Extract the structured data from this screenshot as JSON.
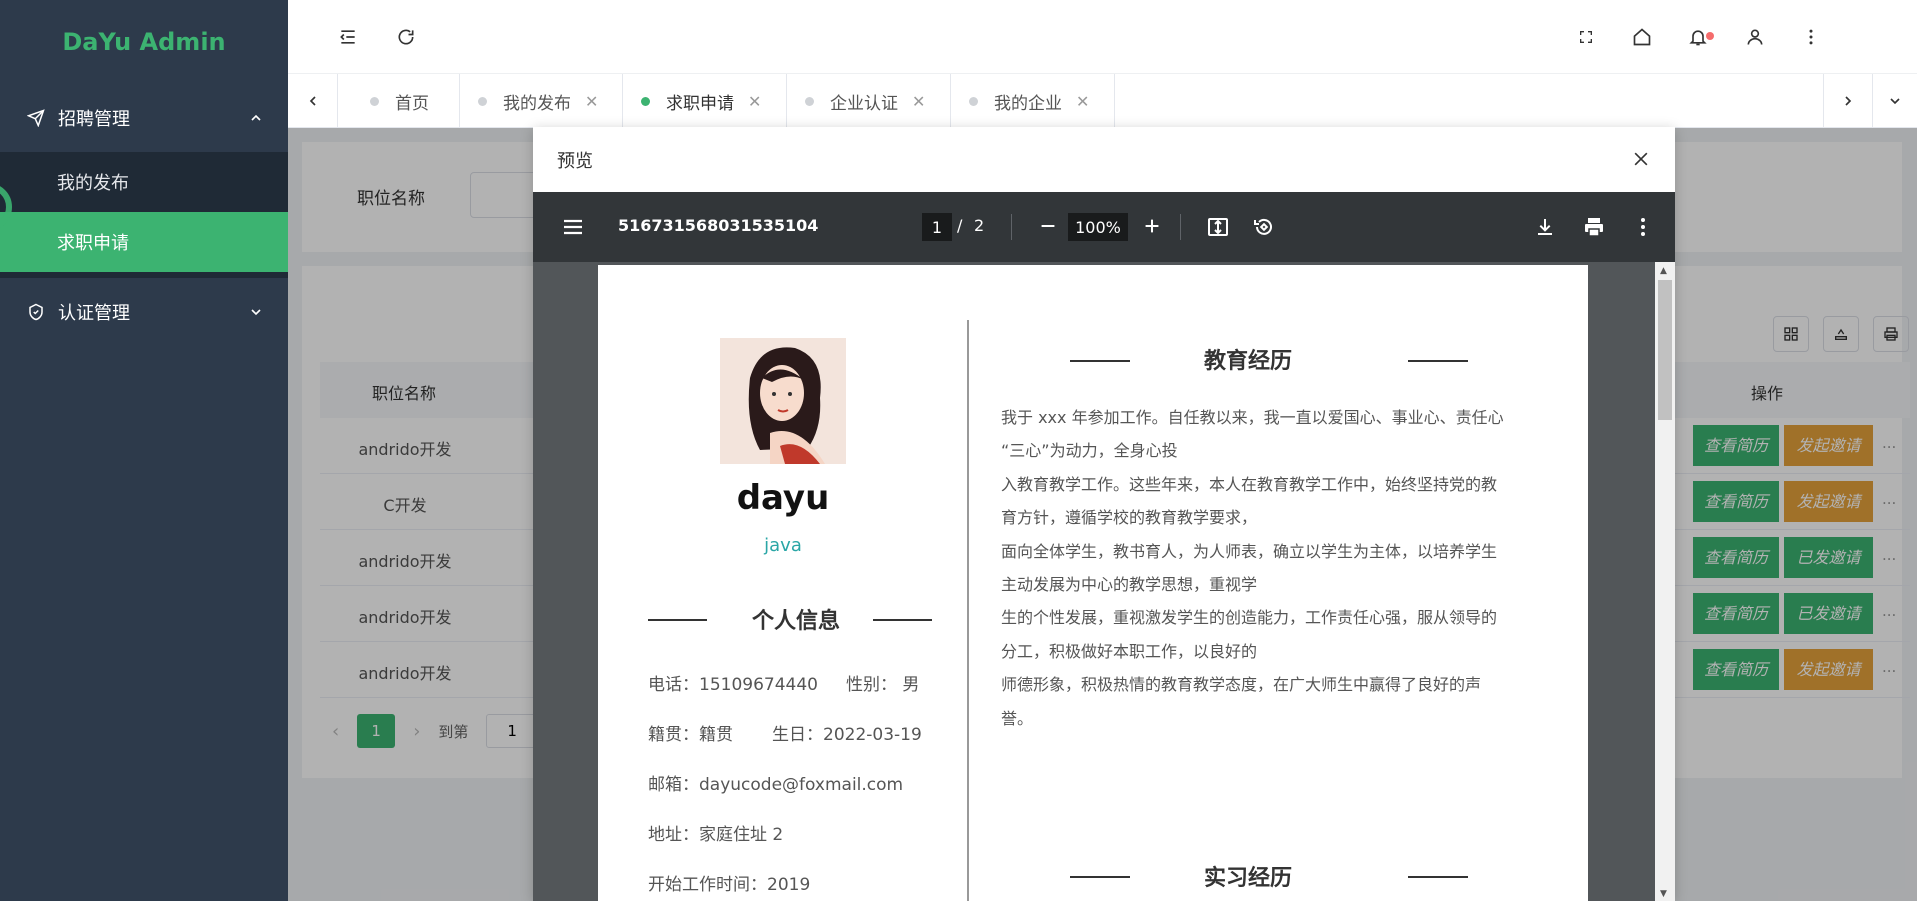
{
  "app": {
    "title": "DaYu Admin"
  },
  "sidebar": {
    "groups": [
      {
        "label": "招聘管理",
        "items": [
          {
            "label": "我的发布"
          },
          {
            "label": "求职申请"
          }
        ]
      },
      {
        "label": "认证管理"
      }
    ]
  },
  "tabs": [
    {
      "label": "首页"
    },
    {
      "label": "我的发布"
    },
    {
      "label": "求职申请"
    },
    {
      "label": "企业认证"
    },
    {
      "label": "我的企业"
    }
  ],
  "background": {
    "filter_label": "职位名称",
    "table": {
      "col_title": "职位名称",
      "col_ops": "操作",
      "rows": [
        {
          "title": "andrido开发",
          "view": "查看简历",
          "invite": "发起邀请",
          "invited": false
        },
        {
          "title": "C开发",
          "view": "查看简历",
          "invite": "发起邀请",
          "invited": false
        },
        {
          "title": "andrido开发",
          "view": "查看简历",
          "invite": "已发邀请",
          "invited": true
        },
        {
          "title": "andrido开发",
          "view": "查看简历",
          "invite": "已发邀请",
          "invited": true
        },
        {
          "title": "andrido开发",
          "view": "查看简历",
          "invite": "发起邀请",
          "invited": false
        }
      ],
      "more": "..."
    },
    "pagination": {
      "current": "1",
      "goto_label": "到第",
      "goto_value": "1"
    }
  },
  "dialog": {
    "title": "预览",
    "pdf": {
      "filename": "516731568031535104",
      "page_current": "1",
      "page_sep": "/",
      "page_total": "2",
      "zoom": "100%"
    },
    "resume": {
      "name": "dayu",
      "position": "java",
      "personal_heading": "个人信息",
      "phone": "电话：15109674440",
      "gender": "性别：  男",
      "origin": "籍贯：籍贯",
      "birthday": "生日：2022-03-19",
      "email": "邮箱：dayucode@foxmail.com",
      "address": "地址：家庭住址 2",
      "start_work": "开始工作时间：2019",
      "education_heading": "教育经历",
      "education_lines": [
        "我于 xxx 年参加工作。自任教以来，我一直以爱国心、事业心、责任心",
        "“三心”为动力，全身心投",
        "入教育教学工作。这些年来，本人在教育教学工作中，始终坚持党的教",
        "育方针，遵循学校的教育教学要求，",
        "面向全体学生，教书育人，为人师表，确立以学生为主体，以培养学生",
        "主动发展为中心的教学思想，重视学",
        "生的个性发展，重视激发学生的创造能力，工作责任心强，服从领导的",
        "分工，积极做好本职工作，以良好的",
        "师德形象，积极热情的教育教学态度，在广大师生中赢得了良好的声",
        "誉。"
      ],
      "internship_heading": "实习经历"
    }
  },
  "colors": {
    "accent": "#3cb371",
    "sidebar": "#2d3a4b",
    "orange": "#e6a23c",
    "pdf_bar": "#323639"
  }
}
